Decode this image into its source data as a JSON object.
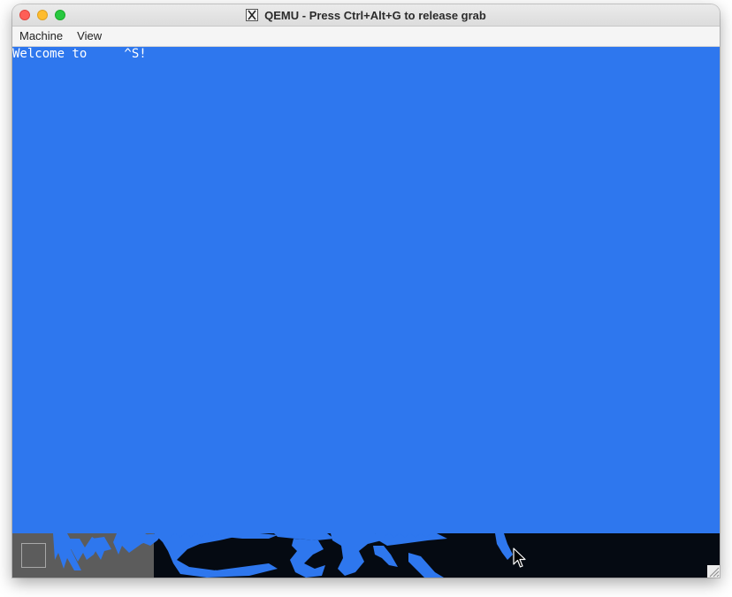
{
  "window": {
    "title": "QEMU - Press Ctrl+Alt+G to release grab",
    "app_icon": "x11-icon"
  },
  "menubar": {
    "items": [
      {
        "label": "Machine"
      },
      {
        "label": "View"
      }
    ]
  },
  "guest_display": {
    "background_color": "#2e77ee",
    "console_text": "Welcome to     ^S!",
    "bottom_strip_color": "#050a12",
    "artifact_color": "#2e77ee"
  },
  "icons": {
    "close": "close-icon",
    "minimize": "minimize-icon",
    "zoom": "zoom-icon",
    "cursor": "mouse-pointer-icon",
    "resize": "resize-grip-icon"
  }
}
